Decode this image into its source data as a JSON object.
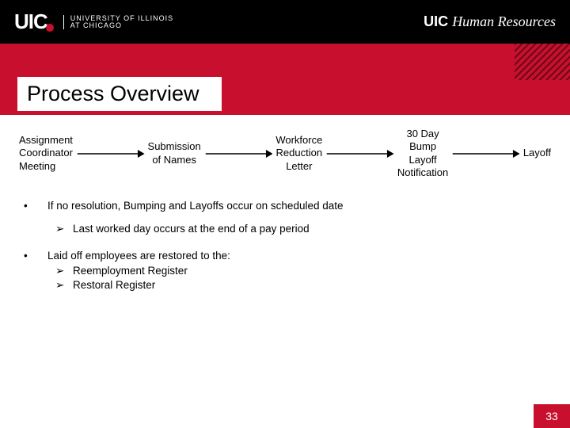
{
  "header": {
    "logo_mark": "UIC",
    "logo_line1": "UNIVERSITY OF ILLINOIS",
    "logo_line2": "AT CHICAGO",
    "right_bold": "UIC",
    "right_italic": "Human Resources"
  },
  "title": "Process Overview",
  "flow": {
    "step1": "Assignment\nCoordinator\nMeeting",
    "step2": "Submission\nof Names",
    "step3": "Workforce\nReduction\nLetter",
    "step4": "30 Day\nBump\nLayoff\nNotification",
    "step5": "Layoff"
  },
  "bullets": {
    "b1": "If no resolution, Bumping and Layoffs occur on scheduled date",
    "b1_sub1": "Last worked day occurs at the end of a pay period",
    "b2": "Laid off employees are restored to the:",
    "b2_sub1": "Reemployment Register",
    "b2_sub2": "Restoral Register"
  },
  "markers": {
    "dot": "•",
    "tri": "➢"
  },
  "page_number": "33"
}
